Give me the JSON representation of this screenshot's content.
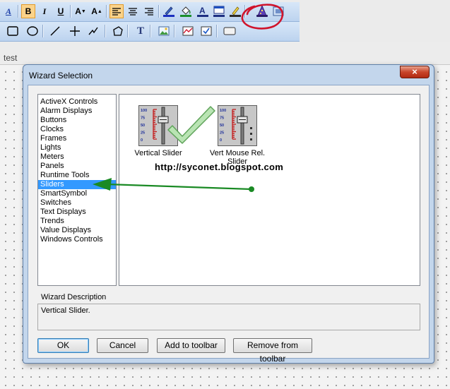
{
  "toolbar1": {
    "buttons": [
      {
        "name": "font-style-icon",
        "glyph": "A"
      },
      {
        "name": "bold-button",
        "glyph": "B"
      },
      {
        "name": "italic-button",
        "glyph": "I"
      },
      {
        "name": "underline-button",
        "glyph": "U"
      },
      {
        "name": "decrease-font-button",
        "glyph": "A"
      },
      {
        "name": "increase-font-button",
        "glyph": "A"
      }
    ]
  },
  "document": {
    "title": "test"
  },
  "dialog": {
    "title": "Wizard Selection",
    "close_glyph": "×",
    "categories": [
      "ActiveX Controls",
      "Alarm Displays",
      "Buttons",
      "Clocks",
      "Frames",
      "Lights",
      "Meters",
      "Panels",
      "Runtime Tools",
      "Sliders",
      "SmartSymbol",
      "Switches",
      "Text Displays",
      "Trends",
      "Value Displays",
      "Windows Controls"
    ],
    "selected_category": "Sliders",
    "wizards": [
      {
        "label": "Vertical Slider",
        "ticks": [
          "100",
          "75",
          "50",
          "25",
          "0"
        ]
      },
      {
        "label": "Vert Mouse Rel. Slider",
        "ticks": [
          "100",
          "75",
          "50",
          "25",
          "0"
        ]
      }
    ],
    "description_label": "Wizard Description",
    "description_text": "Vertical Slider.",
    "buttons": {
      "ok": "OK",
      "cancel": "Cancel",
      "add": "Add to toolbar",
      "remove": "Remove from  toolbar"
    }
  },
  "watermark": "http://syconet.blogspot.com",
  "colors": {
    "annotation_red": "#d0142c",
    "arrow_green": "#1a8a24",
    "check_green": "#9fd69a",
    "selection_blue": "#3399ff"
  }
}
